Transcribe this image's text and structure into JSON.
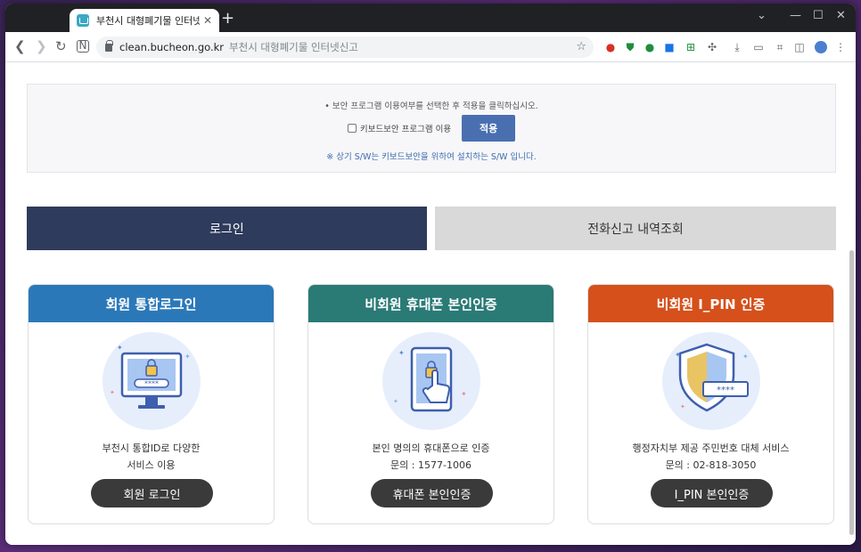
{
  "browser": {
    "tab_title": "부천시 대형폐기물 인터넷신고",
    "tab_close": "✕",
    "new_tab": "+",
    "host": "clean.bucheon.go.kr",
    "page_title": "부천시 대형폐기물 인터넷신고",
    "win_min": "—",
    "win_max": "☐",
    "win_close": "✕",
    "win_chevron": "⌄"
  },
  "security": {
    "note": "• 보안 프로그램 이용여부를 선택한 후 적용을 클릭하십시오.",
    "checkbox_label": "키보드보안 프로그램 이용",
    "apply_button": "적용",
    "sub_note": "※ 상기 S/W는 키보드보안을 위하여 설치하는 S/W 입니다."
  },
  "tabs": {
    "login": "로그인",
    "phone_history": "전화신고 내역조회"
  },
  "cards": [
    {
      "title": "회원 통합로그인",
      "color": "#2b78b9",
      "desc_line1": "부천시 통합ID로 다양한",
      "desc_line2": "서비스 이용",
      "button": "회원 로그인"
    },
    {
      "title": "비회원 휴대폰 본인인증",
      "color": "#2a7a76",
      "desc_line1": "본인 명의의 휴대폰으로 인증",
      "desc_line2": "문의 : 1577-1006",
      "button": "휴대폰 본인인증"
    },
    {
      "title": "비회원 I_PIN 인증",
      "color": "#d5501b",
      "desc_line1": "행정자치부 제공 주민번호 대체 서비스",
      "desc_line2": "문의 : 02-818-3050",
      "button": "I_PIN 본인인증"
    }
  ],
  "illustration_text": {
    "pw_dots": "****",
    "pin_stars": "****"
  }
}
